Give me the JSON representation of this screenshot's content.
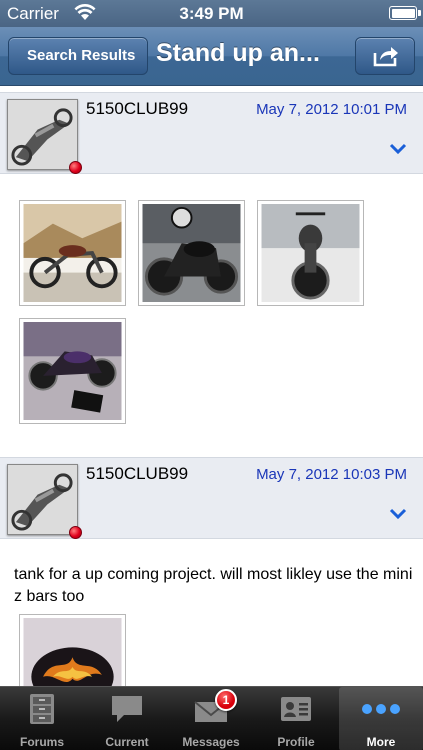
{
  "status_bar": {
    "carrier": "Carrier",
    "time": "3:49 PM"
  },
  "nav": {
    "back_label": "Search Results",
    "title": "Stand up an...",
    "share_icon": "share-icon"
  },
  "posts": [
    {
      "username": "5150CLUB99",
      "date": "May 7, 2012 10:01 PM",
      "online": true,
      "text": "",
      "attachments": 4
    },
    {
      "username": "5150CLUB99",
      "date": "May 7, 2012 10:03 PM",
      "online": true,
      "text": "tank for a up coming project. will most likley use the mini z bars too",
      "attachments": 1
    }
  ],
  "tab_bar": {
    "tabs": [
      {
        "label": "Forums",
        "icon": "cabinet-icon"
      },
      {
        "label": "Current",
        "icon": "speech-bubble-icon"
      },
      {
        "label": "Messages",
        "icon": "envelope-icon",
        "badge": "1"
      },
      {
        "label": "Profile",
        "icon": "id-card-icon"
      },
      {
        "label": "More",
        "icon": "more-dots-icon",
        "active": true
      }
    ]
  },
  "colors": {
    "nav_blue": "#4f78a6",
    "date_blue": "#1a36b8",
    "header_gray": "#e9ecf2",
    "online_red": "#e0001c"
  }
}
